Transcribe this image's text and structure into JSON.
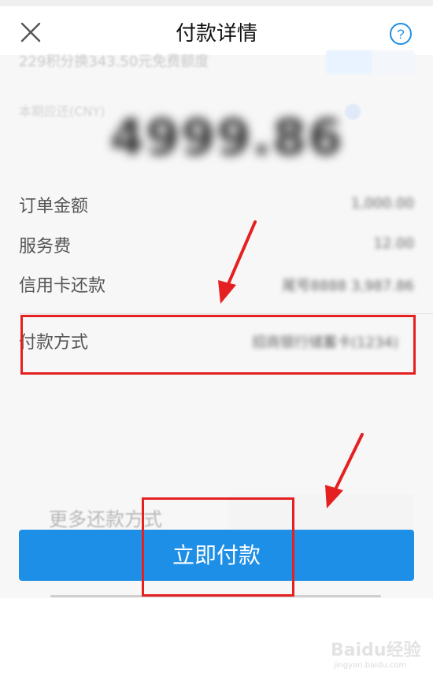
{
  "header": {
    "title": "付款详情"
  },
  "promo": {
    "text": "229积分换343.50元免费额度"
  },
  "summary": {
    "subline": "本期应还(CNY)",
    "amount": "4999.86"
  },
  "details": [
    {
      "label": "订单金额",
      "value": "1,000.00"
    },
    {
      "label": "服务费",
      "value": "12.00"
    },
    {
      "label": "信用卡还款",
      "value": "尾号8888 3,987.86"
    }
  ],
  "payment_method": {
    "label": "付款方式",
    "value": "招商银行储蓄卡(1234)"
  },
  "more_options": "更多还款方式",
  "pay_button": "立即付款",
  "watermark": {
    "brand": "Baidu经验",
    "domain": "jingyan.baidu.com"
  },
  "colors": {
    "accent": "#1e8fe6",
    "annotation": "#e52020"
  }
}
